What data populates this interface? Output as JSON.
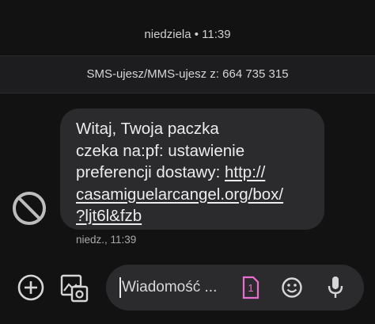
{
  "conversation": {
    "date_header": "niedziela • 11:39",
    "sender_info": "SMS-ujesz/MMS-ujesz z: 664 735 315"
  },
  "message": {
    "lines": [
      "Witaj, Twoja paczka",
      "czeka na:pf: ustawienie",
      "preferencji dostawy: "
    ],
    "link_lines": [
      "http://",
      "casamiguelarcangel.org/box/",
      "?ljt6l&fzb"
    ],
    "timestamp": "niedz., 11:39"
  },
  "compose": {
    "placeholder": "Wiadomość ...",
    "sim_slot": "1"
  },
  "icons": {
    "sender_avatar": "blocked-icon",
    "add": "add-circle-icon",
    "gallery": "gallery-icon",
    "sim": "sim-card-icon",
    "emoji": "emoji-icon",
    "voice": "microphone-icon"
  },
  "colors": {
    "background": "#121212",
    "bubble": "#2b2b2e",
    "sim_accent": "#e86fd0"
  }
}
